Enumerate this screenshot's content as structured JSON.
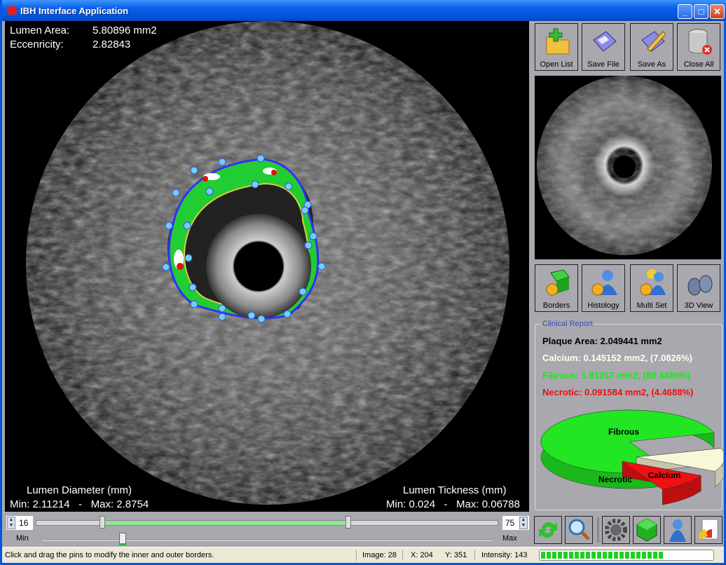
{
  "window": {
    "title": "IBH Interface Application",
    "buttons": [
      "_",
      "□",
      "✕"
    ]
  },
  "overlay": {
    "lumen_area_label": "Lumen Area:",
    "lumen_area_value": "5.80896 mm2",
    "eccentricity_label": "Eccenricity:",
    "eccentricity_value": "2.82843",
    "diameter_title": "Lumen Diameter (mm)",
    "diameter_values": "Min: 2.11214   -   Max: 2.8754",
    "thickness_title": "Lumen Tickness (mm)",
    "thickness_values": "Min: 0.024   -   Max: 0.06788"
  },
  "toolbar": [
    {
      "label": "Open List",
      "icon": "open-folder-icon"
    },
    {
      "label": "Save File",
      "icon": "floppy-icon"
    },
    {
      "label": "Save As",
      "icon": "floppy-pencil-icon"
    },
    {
      "label": "Close All",
      "icon": "database-close-icon"
    }
  ],
  "tools": [
    {
      "label": "Borders",
      "icon": "borders-icon"
    },
    {
      "label": "Histology",
      "icon": "histology-icon"
    },
    {
      "label": "Multi Set",
      "icon": "multi-set-icon"
    },
    {
      "label": "3D View",
      "icon": "binoculars-icon"
    }
  ],
  "report": {
    "title": "Clinical Report",
    "plaque": "Plaque Area: 2.049441 mm2",
    "calcium": "Calcium: 0.145152 mm2, (7.0826%)",
    "fibrous": "Fibrous: 1.81267 mm2, (88.4486%)",
    "necrotic": "Necrotic: 0.091584 mm2, (4.4688%)",
    "colors": {
      "calcium": "#f8f8d8",
      "fibrous": "#22e622",
      "necrotic": "#ee1111"
    }
  },
  "chart_data": {
    "type": "pie",
    "categories": [
      "Fibrous",
      "Calcium",
      "Necrotic"
    ],
    "values": [
      88.4486,
      7.0826,
      4.4688
    ],
    "labels": [
      "Fibrous",
      "Calcium",
      "Necrotic"
    ]
  },
  "range": {
    "min_value": "16",
    "max_value": "75",
    "min_label": "Min",
    "max_label": "Max",
    "low": 16,
    "high": 75,
    "position_fraction": 0.18
  },
  "bottom_icons": [
    "refresh-icon",
    "zoom-icon",
    "gear-icon",
    "cube-icon",
    "user-icon",
    "chart-icon"
  ],
  "status": {
    "message": "Click and drag the pins to modify the inner and outer borders.",
    "image": "Image: 28",
    "x": "X: 204",
    "y": "Y: 351",
    "intensity": "Intensity: 143",
    "progress": 0.72
  }
}
